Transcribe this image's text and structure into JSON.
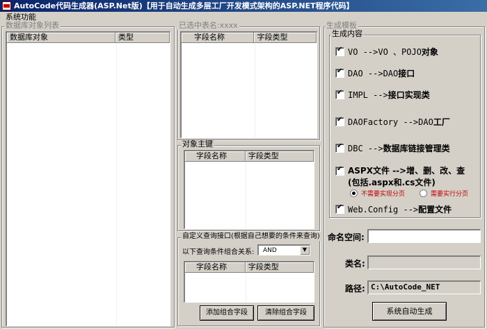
{
  "window": {
    "title": "AutoCode代码生成器(ASP.Net版)【用于自动生成多层工厂开发模式架构的ASP.NET程序代码】"
  },
  "menu": {
    "system": "系统功能"
  },
  "db_panel": {
    "title": "数据库对象列表",
    "columns": [
      "数据库对象",
      "类型"
    ]
  },
  "fields_panel": {
    "title": "已选中表名:xxxx",
    "columns": [
      "字段名称",
      "字段类型"
    ]
  },
  "pk_panel": {
    "title": "对象主键",
    "columns": [
      "字段名称",
      "字段类型"
    ]
  },
  "query_panel": {
    "title": "自定义查询接口(根据自己想要的条件来查询)",
    "relation_label": "以下查询条件组合关系:",
    "relation_value": "AND",
    "columns": [
      "字段名称",
      "字段类型"
    ],
    "add_button": "添加组合字段",
    "clear_button": "清除组合字段"
  },
  "template": {
    "title": "生成模板",
    "content_title": "生成内容",
    "options": {
      "vo_a": "VO -->VO 、POJO",
      "vo_b": "对象",
      "dao_a": "DAO -->DAO",
      "dao_b": "接口",
      "impl_a": "IMPL -->",
      "impl_b": "接口实现类",
      "factory_a": "DAOFactory -->DAO",
      "factory_b": "工厂",
      "dbc_a": "DBC -->",
      "dbc_b": "数据库链接管理类",
      "aspx_line1": "ASPX文件 -->增、删、改、查",
      "aspx_line2": "(包括.aspx和.cs文件)",
      "webconfig_a": "Web.Config -->",
      "webconfig_b": "配置文件"
    },
    "paging": {
      "no": "不需要实现分页",
      "yes": "需要实行分页"
    }
  },
  "form": {
    "namespace_label": "命名空间:",
    "namespace_value": "",
    "classname_label": "类名:",
    "classname_value": "",
    "path_label": "路径:",
    "path_value": "C:\\AutoCode_NET",
    "generate_button": "系统自动生成"
  },
  "colors": {
    "title_bar": "#0a246a",
    "paging_text": "#c00000",
    "face": "#d4d0c8"
  }
}
